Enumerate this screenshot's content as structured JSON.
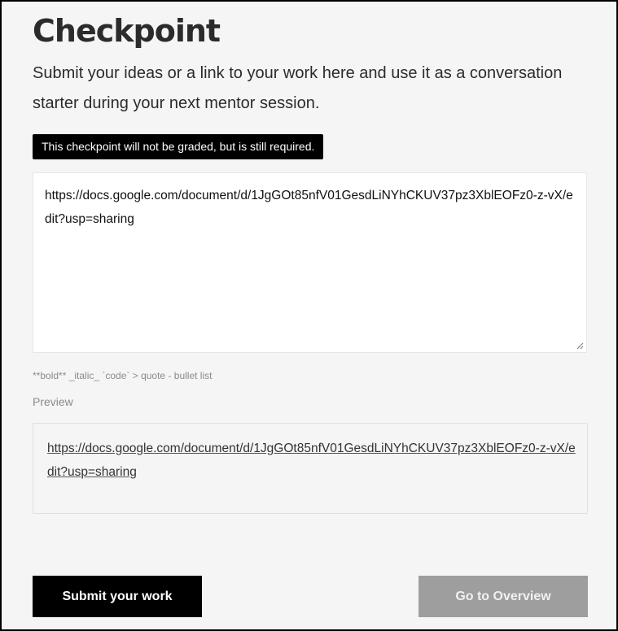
{
  "header": {
    "title": "Checkpoint",
    "subtitle": "Submit your ideas or a link to your work here and use it as a conversation starter during your next mentor session."
  },
  "notice": {
    "text": "This checkpoint will not be graded, but is still required."
  },
  "editor": {
    "value": "https://docs.google.com/document/d/1JgGOt85nfV01GesdLiNYhCKUV37pz3XblEOFz0-z-vX/edit?usp=sharing",
    "format_hint": "**bold** _italic_ `code` > quote - bullet list"
  },
  "preview": {
    "label": "Preview",
    "link_text": "https://docs.google.com/document/d/1JgGOt85nfV01GesdLiNYhCKUV37pz3XblEOFz0-z-vX/edit?usp=sharing"
  },
  "actions": {
    "submit_label": "Submit your work",
    "overview_label": "Go to Overview"
  },
  "colors": {
    "primary_button": "#000000",
    "secondary_button_disabled": "#9e9e9e",
    "background": "#f5f5f5"
  }
}
